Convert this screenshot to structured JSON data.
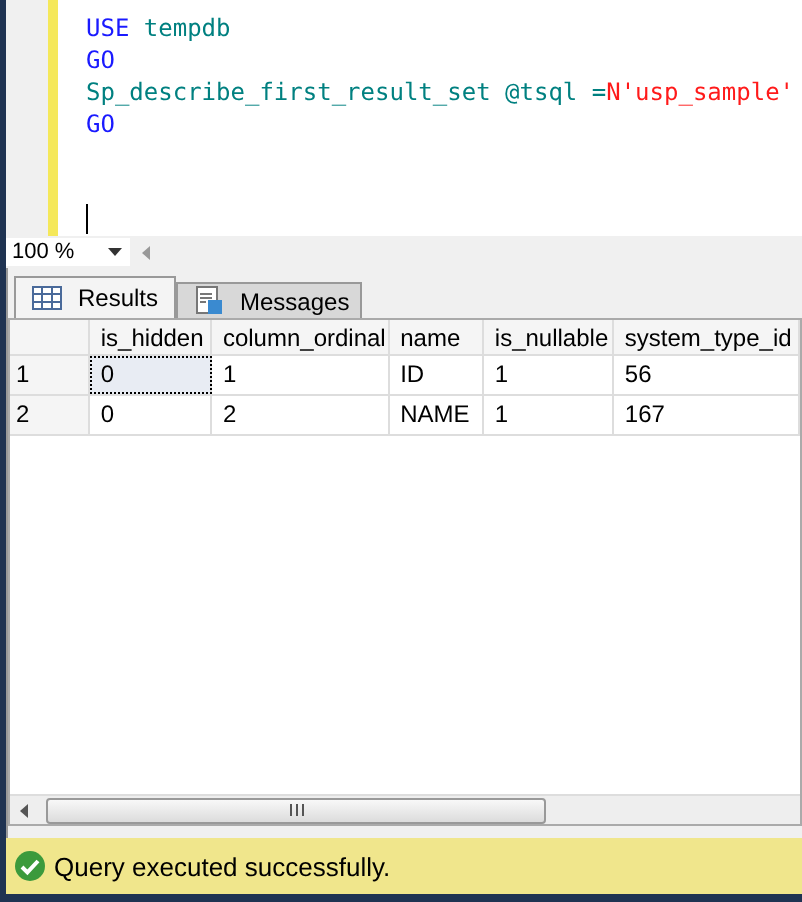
{
  "editor": {
    "lines": [
      [
        {
          "kind": "keyword",
          "text": "USE"
        },
        {
          "kind": "ident",
          "text": " tempdb"
        }
      ],
      [
        {
          "kind": "keyword",
          "text": "GO"
        }
      ],
      [
        {
          "kind": "ident",
          "text": "Sp_describe_first_result_set @tsql ="
        },
        {
          "kind": "string",
          "text": "N'usp_sample'"
        }
      ],
      [
        {
          "kind": "keyword",
          "text": "GO"
        }
      ]
    ]
  },
  "zoom": {
    "value": "100 %"
  },
  "tabs": [
    {
      "label": "Results",
      "kind": "grid",
      "selected": true
    },
    {
      "label": "Messages",
      "kind": "messages",
      "selected": false
    }
  ],
  "table": {
    "columns": [
      "is_hidden",
      "column_ordinal",
      "name",
      "is_nullable",
      "system_type_id"
    ],
    "rows": [
      {
        "number": "1",
        "selected": true,
        "cells": [
          "0",
          "1",
          "ID",
          "1",
          "56"
        ]
      },
      {
        "number": "2",
        "selected": false,
        "cells": [
          "0",
          "2",
          "NAME",
          "1",
          "167"
        ]
      }
    ]
  },
  "status_bar": {
    "text": "Query executed successfully.",
    "kind": "success"
  }
}
